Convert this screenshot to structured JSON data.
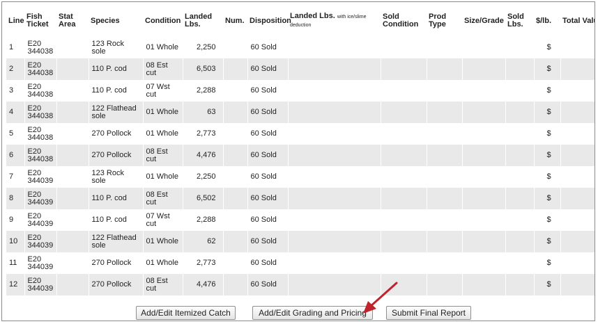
{
  "columns": [
    "Line",
    "Fish Ticket",
    "Stat Area",
    "Species",
    "Condition",
    "Landed Lbs.",
    "Num.",
    "Disposition",
    "Landed Lbs.",
    "Sold Condition",
    "Prod Type",
    "Size/Grade",
    "Sold Lbs.",
    "$/lb.",
    "Total Value"
  ],
  "landed_lbs_note": "with ice/slime deduction",
  "rows": [
    {
      "line": "1",
      "ticket": "E20 344038",
      "species": "123 Rock sole",
      "condition": "01 Whole",
      "landed": "2,250",
      "disposition": "60 Sold",
      "price": "$",
      "total": "$"
    },
    {
      "line": "2",
      "ticket": "E20 344038",
      "species": "110 P. cod",
      "condition": "08 Est cut",
      "landed": "6,503",
      "disposition": "60 Sold",
      "price": "$",
      "total": "$"
    },
    {
      "line": "3",
      "ticket": "E20 344038",
      "species": "110 P. cod",
      "condition": "07 Wst cut",
      "landed": "2,288",
      "disposition": "60 Sold",
      "price": "$",
      "total": "$"
    },
    {
      "line": "4",
      "ticket": "E20 344038",
      "species": "122 Flathead sole",
      "condition": "01 Whole",
      "landed": "63",
      "disposition": "60 Sold",
      "price": "$",
      "total": "$"
    },
    {
      "line": "5",
      "ticket": "E20 344038",
      "species": "270 Pollock",
      "condition": "01 Whole",
      "landed": "2,773",
      "disposition": "60 Sold",
      "price": "$",
      "total": "$"
    },
    {
      "line": "6",
      "ticket": "E20 344038",
      "species": "270 Pollock",
      "condition": "08 Est cut",
      "landed": "4,476",
      "disposition": "60 Sold",
      "price": "$",
      "total": "$"
    },
    {
      "line": "7",
      "ticket": "E20 344039",
      "species": "123 Rock sole",
      "condition": "01 Whole",
      "landed": "2,250",
      "disposition": "60 Sold",
      "price": "$",
      "total": "$"
    },
    {
      "line": "8",
      "ticket": "E20 344039",
      "species": "110 P. cod",
      "condition": "08 Est cut",
      "landed": "6,502",
      "disposition": "60 Sold",
      "price": "$",
      "total": "$"
    },
    {
      "line": "9",
      "ticket": "E20 344039",
      "species": "110 P. cod",
      "condition": "07 Wst cut",
      "landed": "2,288",
      "disposition": "60 Sold",
      "price": "$",
      "total": "$"
    },
    {
      "line": "10",
      "ticket": "E20 344039",
      "species": "122 Flathead sole",
      "condition": "01 Whole",
      "landed": "62",
      "disposition": "60 Sold",
      "price": "$",
      "total": "$"
    },
    {
      "line": "11",
      "ticket": "E20 344039",
      "species": "270 Pollock",
      "condition": "01 Whole",
      "landed": "2,773",
      "disposition": "60 Sold",
      "price": "$",
      "total": "$"
    },
    {
      "line": "12",
      "ticket": "E20 344039",
      "species": "270 Pollock",
      "condition": "08 Est cut",
      "landed": "4,476",
      "disposition": "60 Sold",
      "price": "$",
      "total": "$"
    }
  ],
  "buttons": {
    "itemized": "Add/Edit Itemized Catch",
    "grading": "Add/Edit Grading and Pricing",
    "submit": "Submit Final Report"
  },
  "colors": {
    "row_alt": "#e9e9e9",
    "arrow": "#c0232b"
  }
}
